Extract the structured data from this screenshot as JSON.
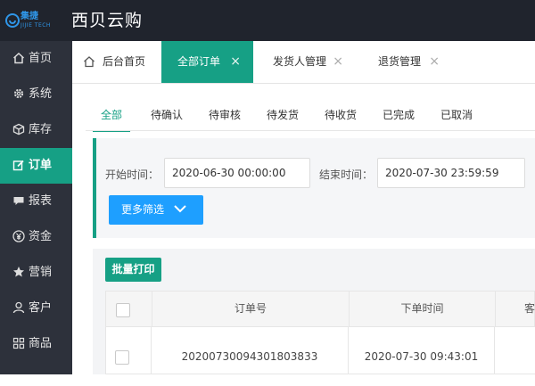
{
  "header": {
    "logo_cn": "集捷",
    "logo_en": "JIJIE TECH",
    "app_title": "西贝云购"
  },
  "sidebar": {
    "items": [
      {
        "label": "首页",
        "icon": "home-icon"
      },
      {
        "label": "系统",
        "icon": "gear-icon"
      },
      {
        "label": "库存",
        "icon": "cube-icon"
      },
      {
        "label": "订单",
        "icon": "edit-icon",
        "active": true
      },
      {
        "label": "报表",
        "icon": "chat-icon"
      },
      {
        "label": "资金",
        "icon": "yen-icon"
      },
      {
        "label": "营销",
        "icon": "star-icon"
      },
      {
        "label": "客户",
        "icon": "user-icon"
      },
      {
        "label": "商品",
        "icon": "grid-icon"
      }
    ]
  },
  "tabs": {
    "home": "后台首页",
    "items": [
      {
        "label": "全部订单",
        "active": true
      },
      {
        "label": "发货人管理"
      },
      {
        "label": "退货管理"
      }
    ],
    "close_glyph": "×"
  },
  "status_tabs": {
    "items": [
      "全部",
      "待确认",
      "待审核",
      "待发货",
      "待收货",
      "已完成",
      "已取消"
    ],
    "active_index": 0
  },
  "filter": {
    "start_label": "开始时间：",
    "start_value": "2020-06-30 00:00:00",
    "end_label": "结束时间：",
    "end_value": "2020-07-30 23:59:59",
    "more_label": "更多筛选"
  },
  "table": {
    "batch_print": "批量打印",
    "columns": [
      "订单号",
      "下单时间",
      "客"
    ],
    "rows": [
      {
        "order_no": "20200730094301803833",
        "order_time": "2020-07-30 09:43:01"
      }
    ]
  },
  "colors": {
    "accent": "#16a085",
    "primary_button": "#1e9fff",
    "topbar": "#20242d",
    "sidebar": "#2d313b"
  }
}
